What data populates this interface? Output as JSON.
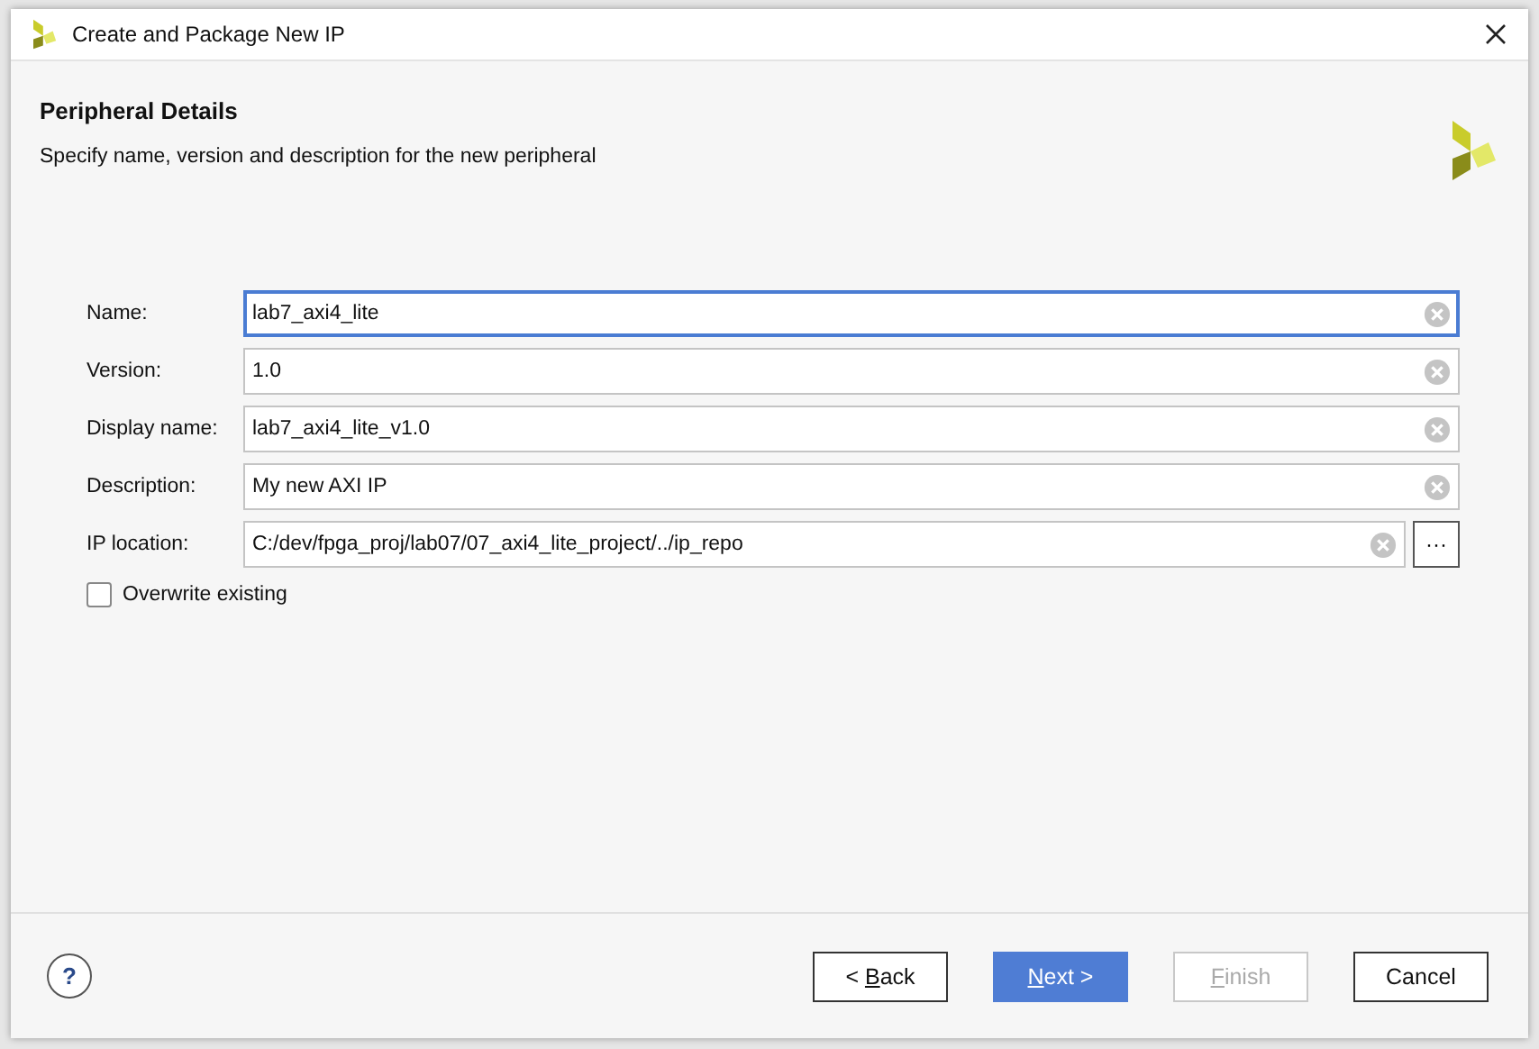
{
  "window": {
    "title": "Create and Package New IP"
  },
  "header": {
    "title": "Peripheral Details",
    "subtitle": "Specify name, version and description for the new peripheral"
  },
  "fields": [
    {
      "label": "Name:",
      "value": "lab7_axi4_lite",
      "focused": true,
      "browse": false
    },
    {
      "label": "Version:",
      "value": "1.0",
      "focused": false,
      "browse": false
    },
    {
      "label": "Display name:",
      "value": "lab7_axi4_lite_v1.0",
      "focused": false,
      "browse": false
    },
    {
      "label": "Description:",
      "value": "My new AXI IP",
      "focused": false,
      "browse": false
    },
    {
      "label": "IP location:",
      "value": "C:/dev/fpga_proj/lab07/07_axi4_lite_project/../ip_repo",
      "focused": false,
      "browse": true
    }
  ],
  "browse_button": "···",
  "overwrite": {
    "label": "Overwrite existing",
    "checked": false
  },
  "help": "?",
  "buttons": [
    {
      "before": "< ",
      "key": "B",
      "after": "ack",
      "kind": "normal",
      "disabled": false
    },
    {
      "key": "N",
      "after": "ext >",
      "kind": "primary",
      "disabled": false
    },
    {
      "key": "F",
      "after": "inish",
      "kind": "normal",
      "disabled": true
    },
    {
      "before": "Cancel",
      "kind": "normal",
      "disabled": false
    }
  ]
}
